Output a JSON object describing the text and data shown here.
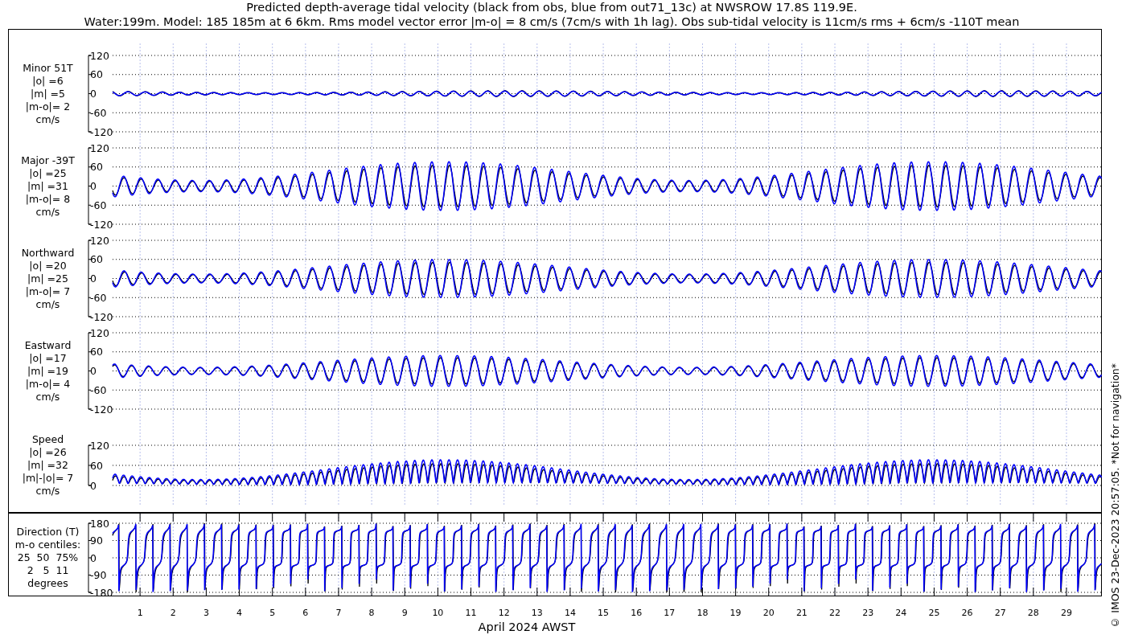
{
  "title_lines": [
    "Predicted depth-average tidal velocity (black from obs, blue from out71_13c) at NWSROW 17.8S 119.9E.",
    "Water:199m. Model: 185 185m at 6 6km. Rms model vector error |m-o| = 8 cm/s (7cm/s with 1h lag). Obs sub-tidal velocity is 11cm/s rms + 6cm/s -110T mean"
  ],
  "panels": [
    {
      "kind": "minor",
      "label_lines": [
        "Minor 51T",
        "|o| =6",
        "|m| =5",
        "|m-o|= 2",
        "cm/s"
      ],
      "yticks": [
        "120",
        "60",
        "0",
        "-60",
        "-120"
      ]
    },
    {
      "kind": "major",
      "label_lines": [
        "Major -39T",
        "|o| =25",
        "|m| =31",
        "|m-o|= 8",
        "cm/s"
      ],
      "yticks": [
        "120",
        "60",
        "0",
        "-60",
        "-120"
      ]
    },
    {
      "kind": "northward",
      "label_lines": [
        "Northward",
        "|o| =20",
        "|m| =25",
        "|m-o|= 7",
        "cm/s"
      ],
      "yticks": [
        "120",
        "60",
        "0",
        "-60",
        "-120"
      ]
    },
    {
      "kind": "eastward",
      "label_lines": [
        "Eastward",
        "|o| =17",
        "|m| =19",
        "|m-o|= 4",
        "cm/s"
      ],
      "yticks": [
        "120",
        "60",
        "0",
        "-60",
        "-120"
      ]
    },
    {
      "kind": "speed",
      "label_lines": [
        "Speed",
        "|o| =26",
        "|m| =32",
        "|m|-|o|= 7",
        "cm/s"
      ],
      "yticks": [
        "120",
        "60",
        "0"
      ]
    },
    {
      "kind": "direction",
      "label_lines": [
        "Direction (T)",
        "m-o centiles:",
        "25  50  75%",
        "2   5  11",
        "degrees"
      ],
      "yticks": [
        "180",
        "90",
        "0",
        "-90",
        "-180"
      ]
    }
  ],
  "xticks": [
    "1",
    "2",
    "3",
    "4",
    "5",
    "6",
    "7",
    "8",
    "9",
    "10",
    "11",
    "12",
    "13",
    "14",
    "15",
    "16",
    "17",
    "18",
    "19",
    "20",
    "21",
    "22",
    "23",
    "24",
    "25",
    "26",
    "27",
    "28",
    "29"
  ],
  "xlabel": "April 2024 AWST",
  "side_note": "© IMOS 23-Dec-2023 20:57:05. *Not for navigation*"
}
